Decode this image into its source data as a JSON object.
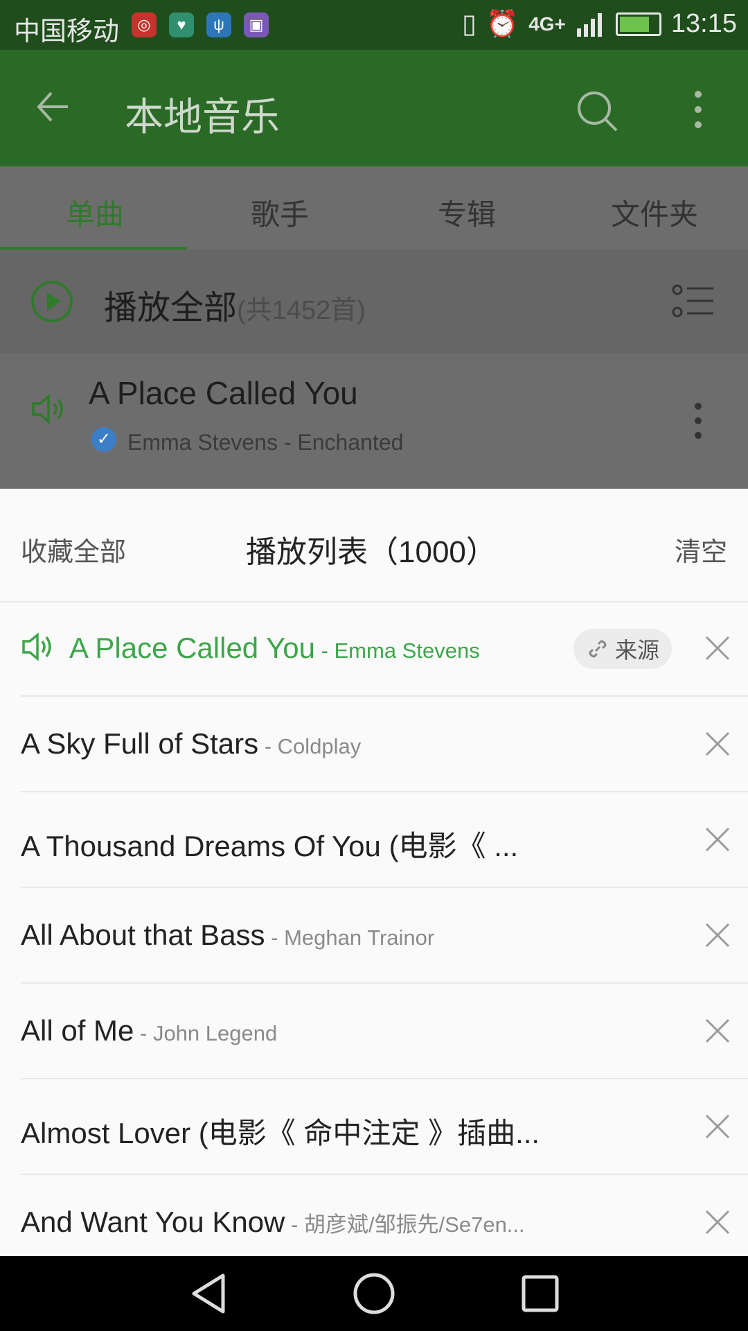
{
  "status_bar": {
    "carrier": "中国移动",
    "network": "4G+",
    "time": "13:15",
    "app_icons": [
      "netease-music-icon",
      "health-icon",
      "usb-icon",
      "gallery-icon"
    ]
  },
  "toolbar": {
    "title": "本地音乐"
  },
  "tabs": [
    {
      "label": "单曲",
      "active": true
    },
    {
      "label": "歌手",
      "active": false
    },
    {
      "label": "专辑",
      "active": false
    },
    {
      "label": "文件夹",
      "active": false
    }
  ],
  "play_all": {
    "label": "播放全部",
    "count": "(共1452首)"
  },
  "now_playing_row": {
    "title": "A Place Called You",
    "subtitle": "Emma Stevens - Enchanted"
  },
  "playlist_sheet": {
    "left_action": "收藏全部",
    "title": "播放列表（1000）",
    "right_action": "清空",
    "source_badge": "来源",
    "items": [
      {
        "title": "A Place Called You",
        "artist": " - Emma Stevens",
        "current": true
      },
      {
        "title": "A Sky Full of Stars",
        "artist": " - Coldplay"
      },
      {
        "title": "A Thousand Dreams Of You (电影《 ...",
        "artist": ""
      },
      {
        "title": "All About that Bass",
        "artist": " - Meghan Trainor"
      },
      {
        "title": "All of Me",
        "artist": " - John Legend"
      },
      {
        "title": "Almost Lover (电影《 命中注定 》插曲...",
        "artist": ""
      },
      {
        "title": "And Want You Know",
        "artist": " - 胡彦斌/邹振先/Se7en..."
      }
    ]
  },
  "colors": {
    "accent_green": "#3da64a",
    "toolbar_green": "#2a6a26",
    "status_bar": "#1f4d1c"
  }
}
